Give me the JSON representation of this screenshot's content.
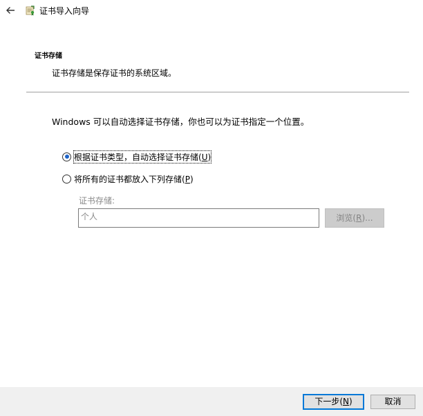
{
  "window": {
    "title": "证书导入向导",
    "back_icon": "arrow-left-icon",
    "wizard_icon": "certificate-wizard-icon"
  },
  "section": {
    "title": "证书存储",
    "description": "证书存储是保存证书的系统区域。"
  },
  "intro": "Windows 可以自动选择证书存储，你也可以为证书指定一个位置。",
  "options": [
    {
      "label_main": "根据证书类型，自动选择证书存储(",
      "mnemonic": "U",
      "label_end": ")",
      "selected": true
    },
    {
      "label_main": "将所有的证书都放入下列存储(",
      "mnemonic": "P",
      "label_end": ")",
      "selected": false
    }
  ],
  "store": {
    "label": "证书存储:",
    "value": "个人",
    "browse_main": "浏览(",
    "browse_mnemonic": "R",
    "browse_end": ")..."
  },
  "footer": {
    "next_main": "下一步(",
    "next_mnemonic": "N",
    "next_end": ")",
    "cancel": "取消"
  },
  "colors": {
    "accent": "#0078d7",
    "radio_dot": "#1e64c8",
    "footer_bg": "#f0f0f0"
  }
}
